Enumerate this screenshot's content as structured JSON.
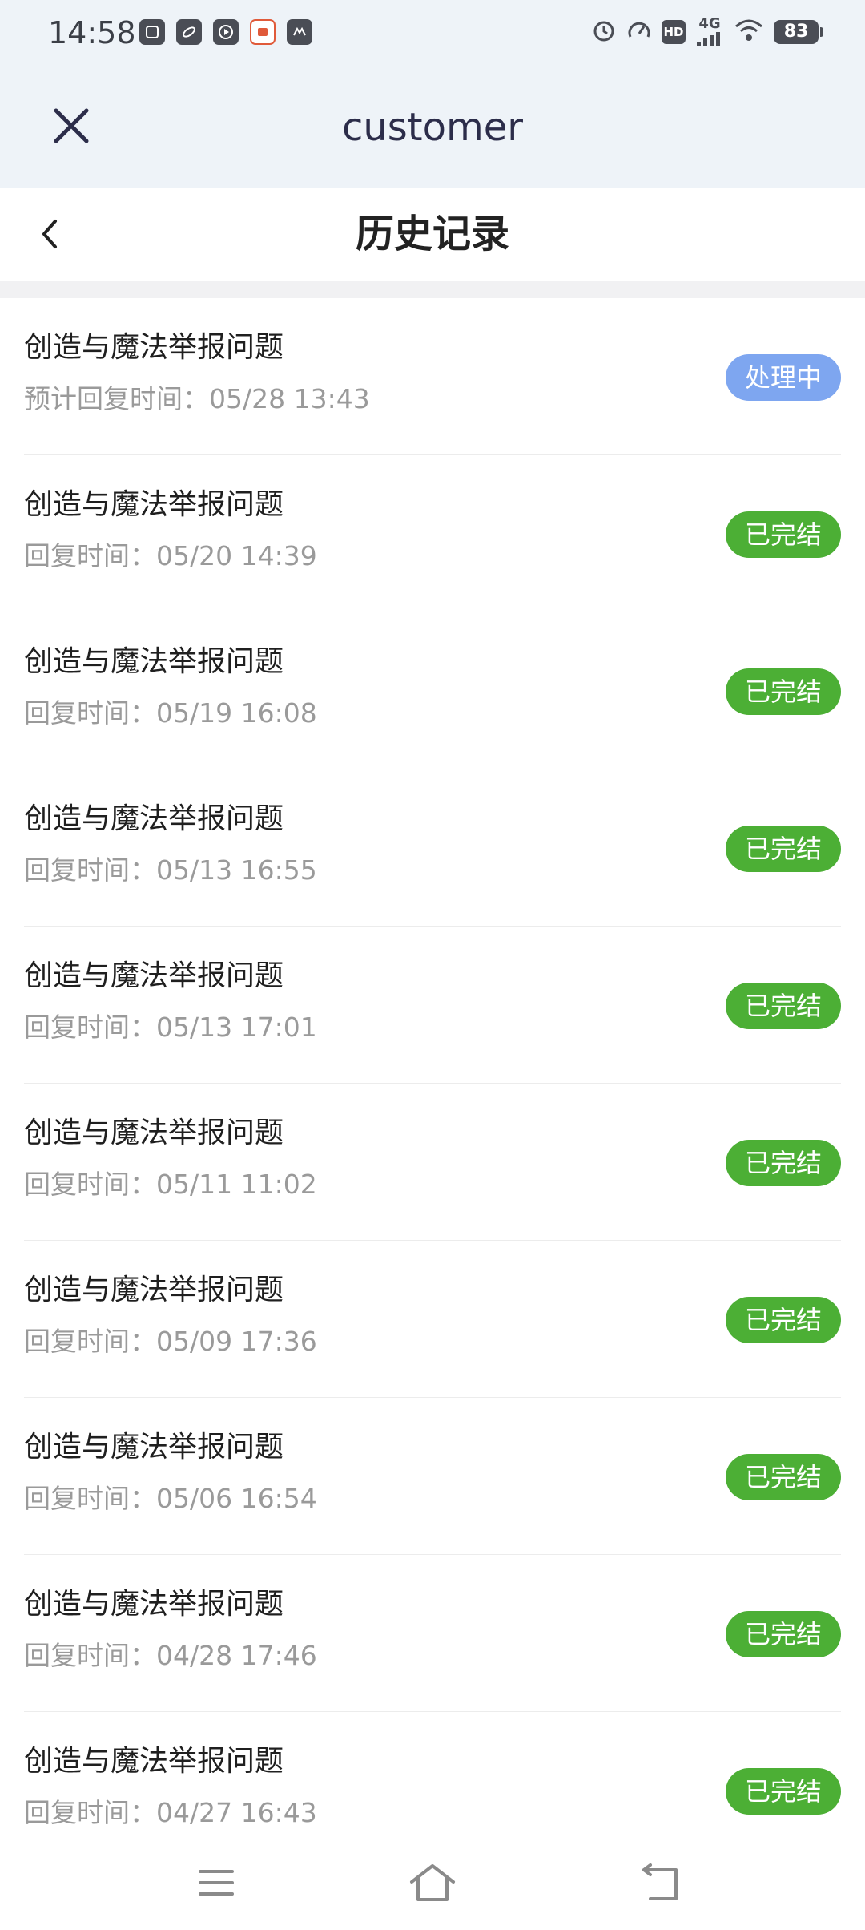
{
  "status_bar": {
    "time": "14:58",
    "network": "4G",
    "hd_label": "HD",
    "battery": "83",
    "app_icons": [
      "app-icon",
      "app-icon",
      "play-icon",
      "app-icon",
      "app-icon"
    ]
  },
  "header": {
    "title": "customer",
    "close_icon": "close-icon"
  },
  "nav": {
    "title": "历史记录",
    "back_icon": "chevron-left-icon"
  },
  "records": [
    {
      "title": "创造与魔法举报问题",
      "time": "预计回复时间：05/28 13:43",
      "status": "处理中",
      "status_color": "#7ea6f0"
    },
    {
      "title": "创造与魔法举报问题",
      "time": "回复时间：05/20 14:39",
      "status": "已完结",
      "status_color": "#4caf35"
    },
    {
      "title": "创造与魔法举报问题",
      "time": "回复时间：05/19 16:08",
      "status": "已完结",
      "status_color": "#4caf35"
    },
    {
      "title": "创造与魔法举报问题",
      "time": "回复时间：05/13 16:55",
      "status": "已完结",
      "status_color": "#4caf35"
    },
    {
      "title": "创造与魔法举报问题",
      "time": "回复时间：05/13 17:01",
      "status": "已完结",
      "status_color": "#4caf35"
    },
    {
      "title": "创造与魔法举报问题",
      "time": "回复时间：05/11 11:02",
      "status": "已完结",
      "status_color": "#4caf35"
    },
    {
      "title": "创造与魔法举报问题",
      "time": "回复时间：05/09 17:36",
      "status": "已完结",
      "status_color": "#4caf35"
    },
    {
      "title": "创造与魔法举报问题",
      "time": "回复时间：05/06 16:54",
      "status": "已完结",
      "status_color": "#4caf35"
    },
    {
      "title": "创造与魔法举报问题",
      "time": "回复时间：04/28 17:46",
      "status": "已完结",
      "status_color": "#4caf35"
    },
    {
      "title": "创造与魔法举报问题",
      "time": "回复时间：04/27 16:43",
      "status": "已完结",
      "status_color": "#4caf35"
    }
  ],
  "bottom_nav": {
    "menu_icon": "menu-icon",
    "home_icon": "home-icon",
    "back_icon": "back-icon"
  },
  "colors": {
    "header_bg": "#eef3f8",
    "processing": "#7ea6f0",
    "completed": "#4caf35"
  }
}
